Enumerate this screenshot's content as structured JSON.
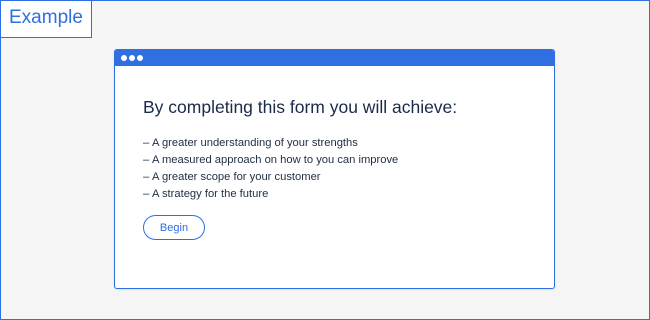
{
  "example_label": "Example",
  "window": {
    "heading": "By completing this form you will achieve:",
    "items": [
      "A greater understanding of your strengths",
      "A measured approach on how to you can improve",
      "A greater scope for your customer",
      "A strategy for the future"
    ],
    "bullet": "–",
    "button_label": "Begin"
  },
  "colors": {
    "accent": "#2f6fe0",
    "background": "#f5f5f5",
    "text": "#1a2a4a"
  }
}
